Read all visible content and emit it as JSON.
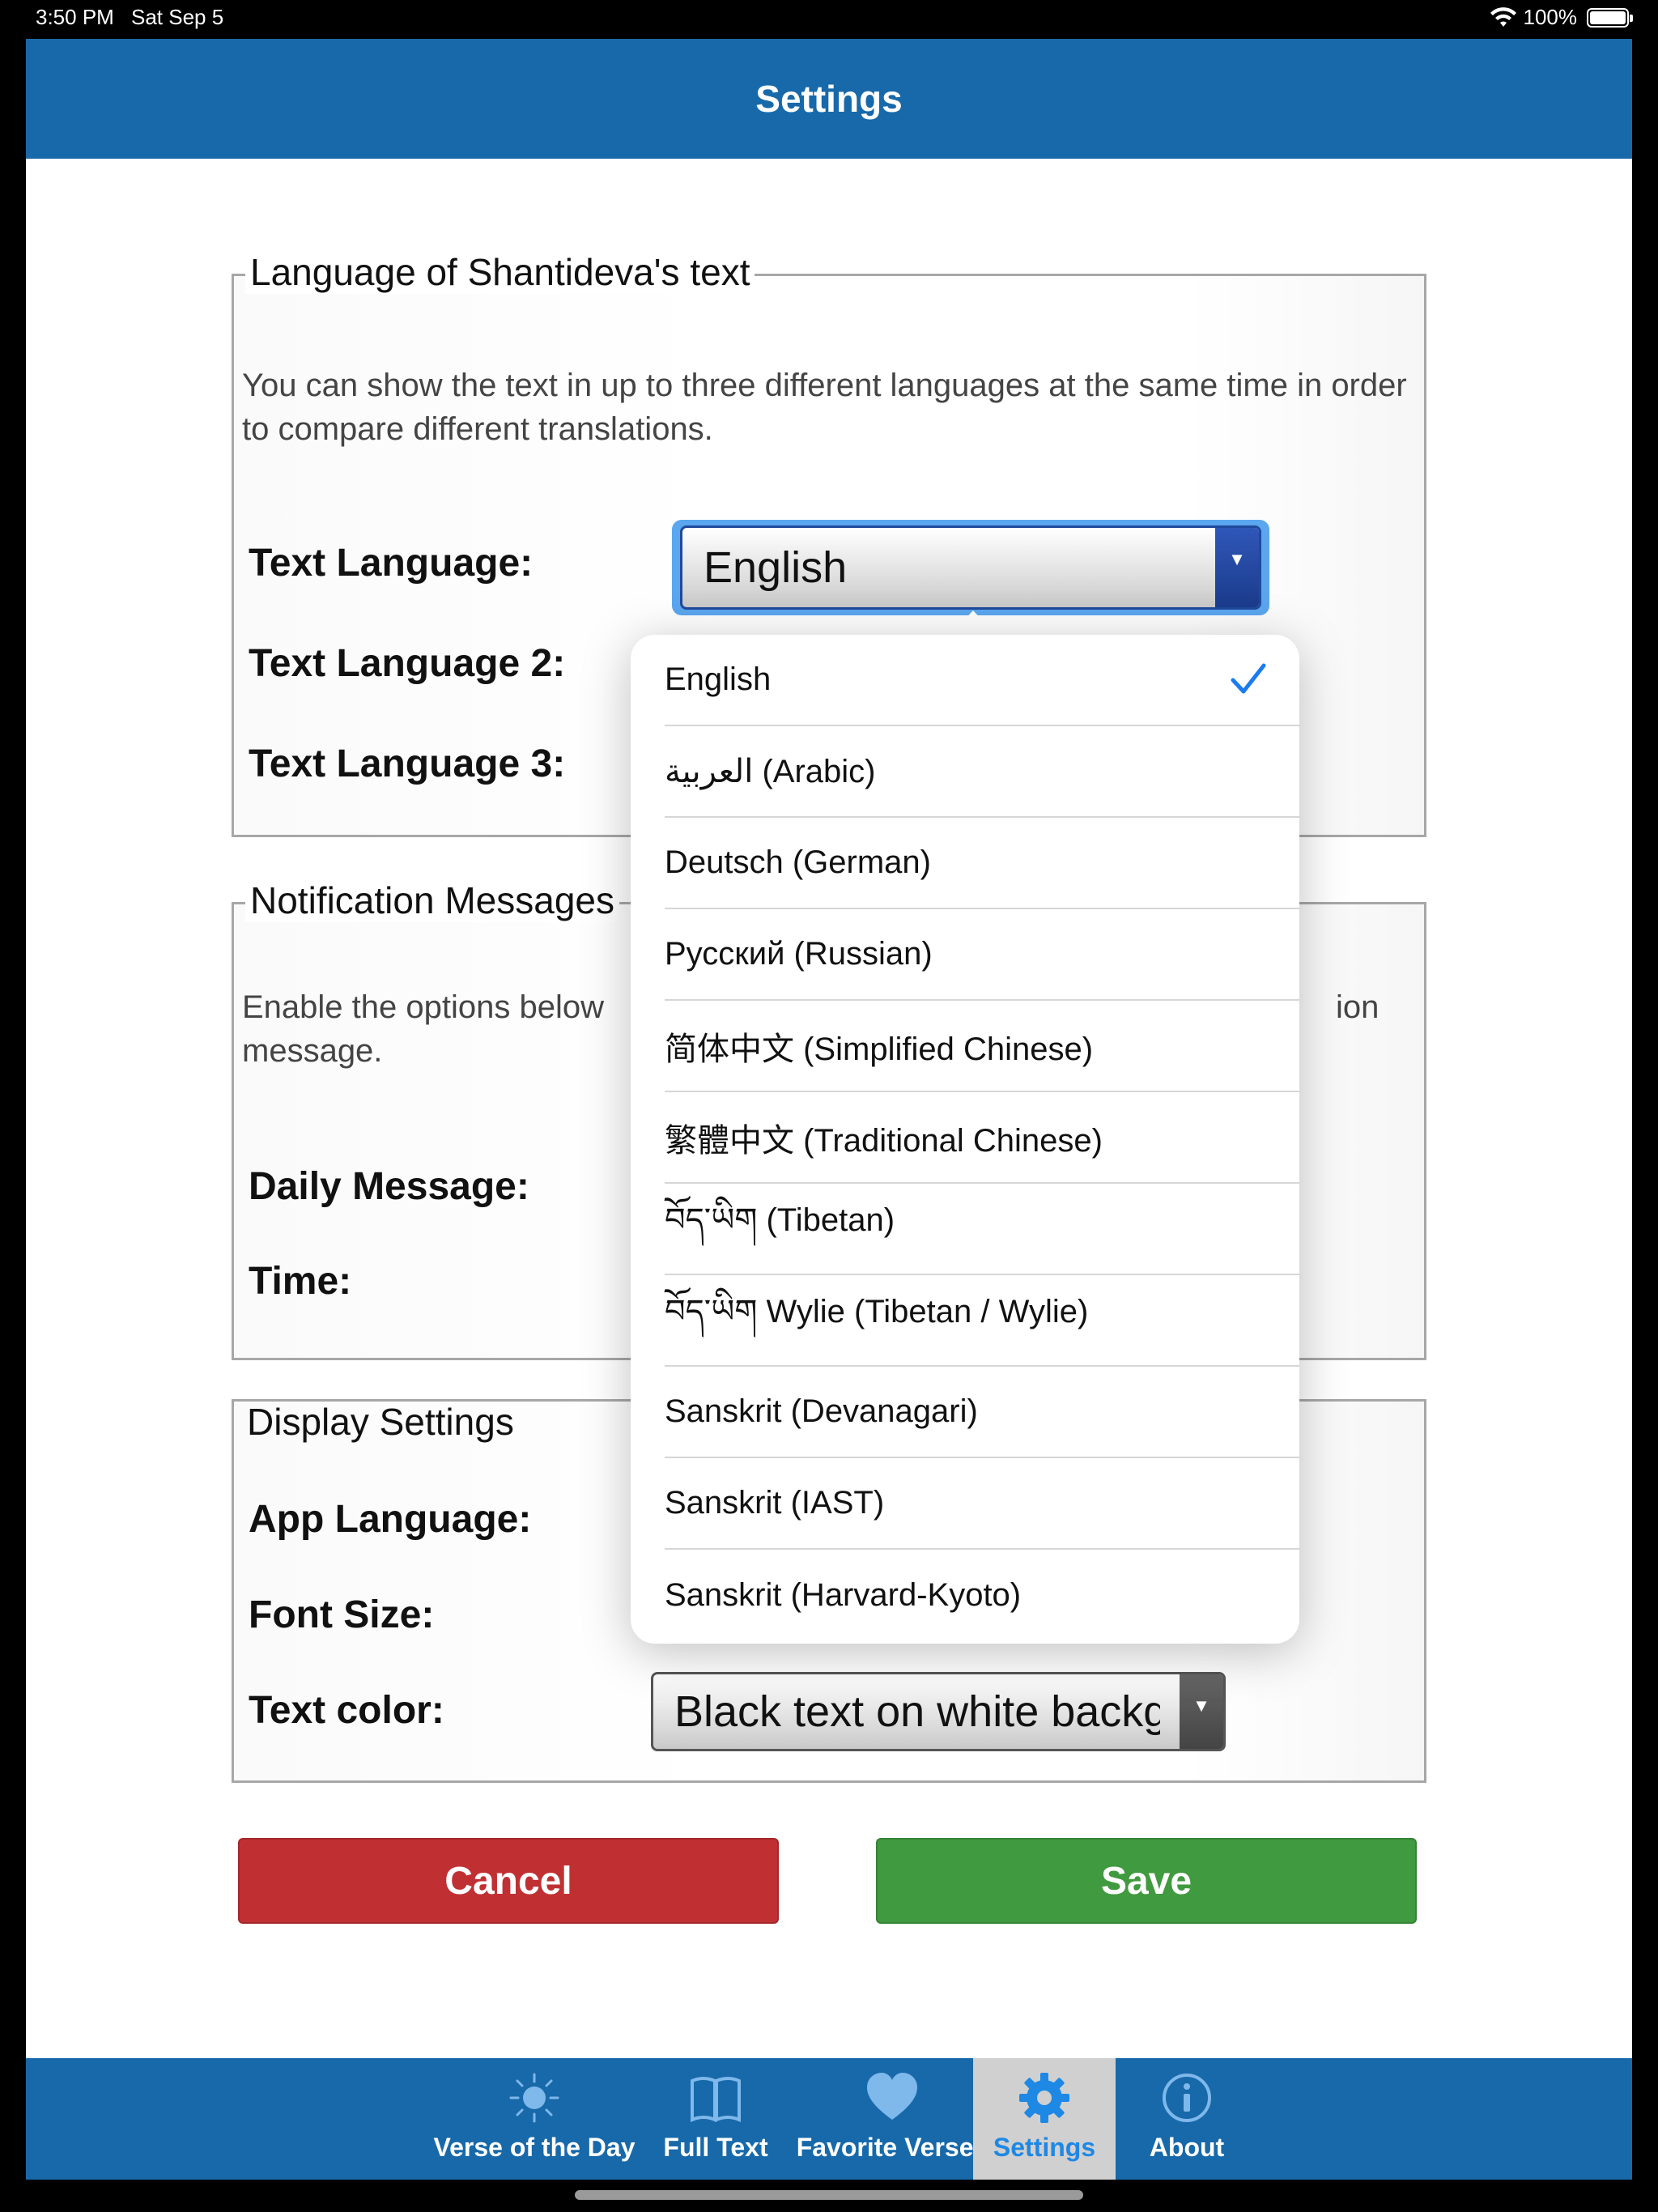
{
  "status_bar": {
    "time": "3:50 PM",
    "date": "Sat Sep 5",
    "battery": "100%"
  },
  "nav": {
    "title": "Settings"
  },
  "language_section": {
    "legend": "Language of Shantideva's text",
    "description": "You can show the text in up to three different languages at the same time in order to compare different translations.",
    "text_language_label": "Text Language:",
    "text_language_value": "English",
    "text_language2_label": "Text Language 2:",
    "text_language3_label": "Text Language 3:"
  },
  "notification_section": {
    "legend": "Notification Messages",
    "description_left": "Enable the options below",
    "description_right": "ion",
    "description_line2": "message.",
    "daily_message_label": "Daily Message:",
    "time_label": "Time:"
  },
  "display_section": {
    "legend": "Display Settings",
    "app_language_label": "App Language:",
    "font_size_label": "Font Size:",
    "text_color_label": "Text color:",
    "text_color_value": "Black text on white backg"
  },
  "buttons": {
    "cancel": "Cancel",
    "save": "Save"
  },
  "dropdown": {
    "selected_index": 0,
    "options": [
      "English",
      "العربية (Arabic)",
      "Deutsch (German)",
      "Русский (Russian)",
      "简体中文 (Simplified Chinese)",
      "繁體中文 (Traditional Chinese)",
      "བོད་ཡིག (Tibetan)",
      "བོད་ཡིག Wylie (Tibetan / Wylie)",
      "Sanskrit (Devanagari)",
      "Sanskrit (IAST)",
      "Sanskrit (Harvard-Kyoto)"
    ]
  },
  "tabs": [
    {
      "label": "Verse of the Day",
      "icon": "sun-icon",
      "active": false
    },
    {
      "label": "Full Text",
      "icon": "book-icon",
      "active": false
    },
    {
      "label": "Favorite Verses",
      "icon": "heart-icon",
      "active": false
    },
    {
      "label": "Settings",
      "icon": "gear-icon",
      "active": true
    },
    {
      "label": "About",
      "icon": "info-icon",
      "active": false
    }
  ],
  "colors": {
    "nav_blue": "#1769aa",
    "cancel_red": "#c03033",
    "save_green": "#409a3f",
    "active_tab_blue": "#1e88e5",
    "check_blue": "#1a7cf0"
  }
}
